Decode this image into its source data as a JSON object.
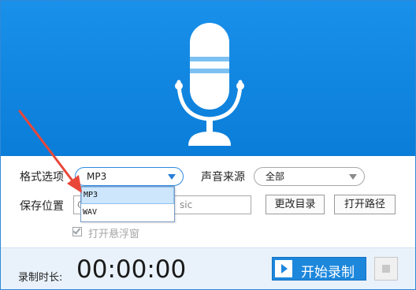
{
  "format": {
    "label": "格式选项",
    "selected": "MP3",
    "options": [
      "MP3",
      "WAV"
    ]
  },
  "source": {
    "label": "声音来源",
    "selected": "全部"
  },
  "save": {
    "label": "保存位置",
    "path_prefix": "C",
    "path_suffix": "sic",
    "change_dir_label": "更改目录",
    "open_path_label": "打开路径"
  },
  "float_window": {
    "label": "打开悬浮窗",
    "checked": true
  },
  "footer": {
    "duration_label": "录制时长:",
    "timer": "00:00:00",
    "record_label": "开始录制"
  },
  "colors": {
    "hero": "#1990ea",
    "accent": "#1d87dc",
    "arrow": "#e8473a"
  },
  "icons": {
    "hero": "microphone-icon",
    "record": "play-icon",
    "stop": "stop-icon",
    "dropdown": "chevron-down-icon"
  }
}
